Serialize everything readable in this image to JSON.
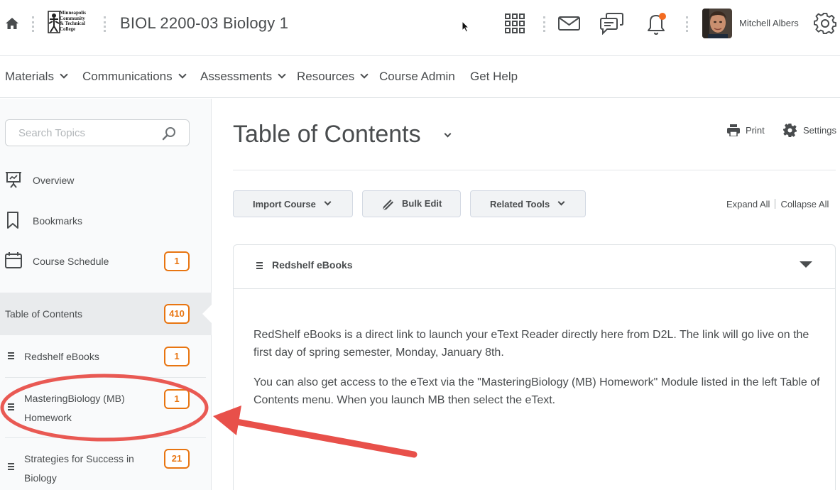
{
  "header": {
    "course_title": "BIOL 2200-03 Biology 1",
    "logo_lines": [
      "Minneapolis",
      "Community",
      "& Technical",
      "College"
    ],
    "user_name": "Mitchell Albers",
    "notification_dot_color": "#f36b21"
  },
  "nav": {
    "items": [
      {
        "label": "Materials",
        "dropdown": true
      },
      {
        "label": "Communications",
        "dropdown": true
      },
      {
        "label": "Assessments",
        "dropdown": true
      },
      {
        "label": "Resources",
        "dropdown": true
      },
      {
        "label": "Course Admin",
        "dropdown": false
      },
      {
        "label": "Get Help",
        "dropdown": false
      }
    ]
  },
  "sidebar": {
    "search_placeholder": "Search Topics",
    "items": [
      {
        "label": "Overview",
        "icon": "presentation-icon"
      },
      {
        "label": "Bookmarks",
        "icon": "bookmark-icon"
      },
      {
        "label": "Course Schedule",
        "icon": "calendar-icon",
        "badge": "1"
      }
    ],
    "toc": {
      "label": "Table of Contents",
      "badge": "410"
    },
    "modules": [
      {
        "label": "Redshelf eBooks",
        "badge": "1"
      },
      {
        "label_line1": "MasteringBiology (MB)",
        "label_line2": "Homework",
        "badge": "1"
      },
      {
        "label_line1": "Strategies for Success in",
        "label_line2": "Biology",
        "badge": "21"
      }
    ]
  },
  "main": {
    "title": "Table of Contents",
    "print_label": "Print",
    "settings_label": "Settings",
    "buttons": {
      "import_course": "Import Course",
      "bulk_edit": "Bulk Edit",
      "related_tools": "Related Tools"
    },
    "expand_all": "Expand All",
    "collapse_all": "Collapse All",
    "module": {
      "title": "Redshelf eBooks",
      "paragraphs": [
        "RedShelf eBooks is a direct link to launch your eText Reader directly here from D2L.  The link will go live on the first day of spring semester, Monday, January 8th.",
        "You can also get access to the eText via the \"MasteringBiology (MB) Homework\" Module listed in the left Table of Contents menu.  When you launch MB then select the eText."
      ]
    }
  },
  "colors": {
    "badge_orange": "#e87511",
    "annotation_red": "#e8504a",
    "text": "#494c4e"
  }
}
